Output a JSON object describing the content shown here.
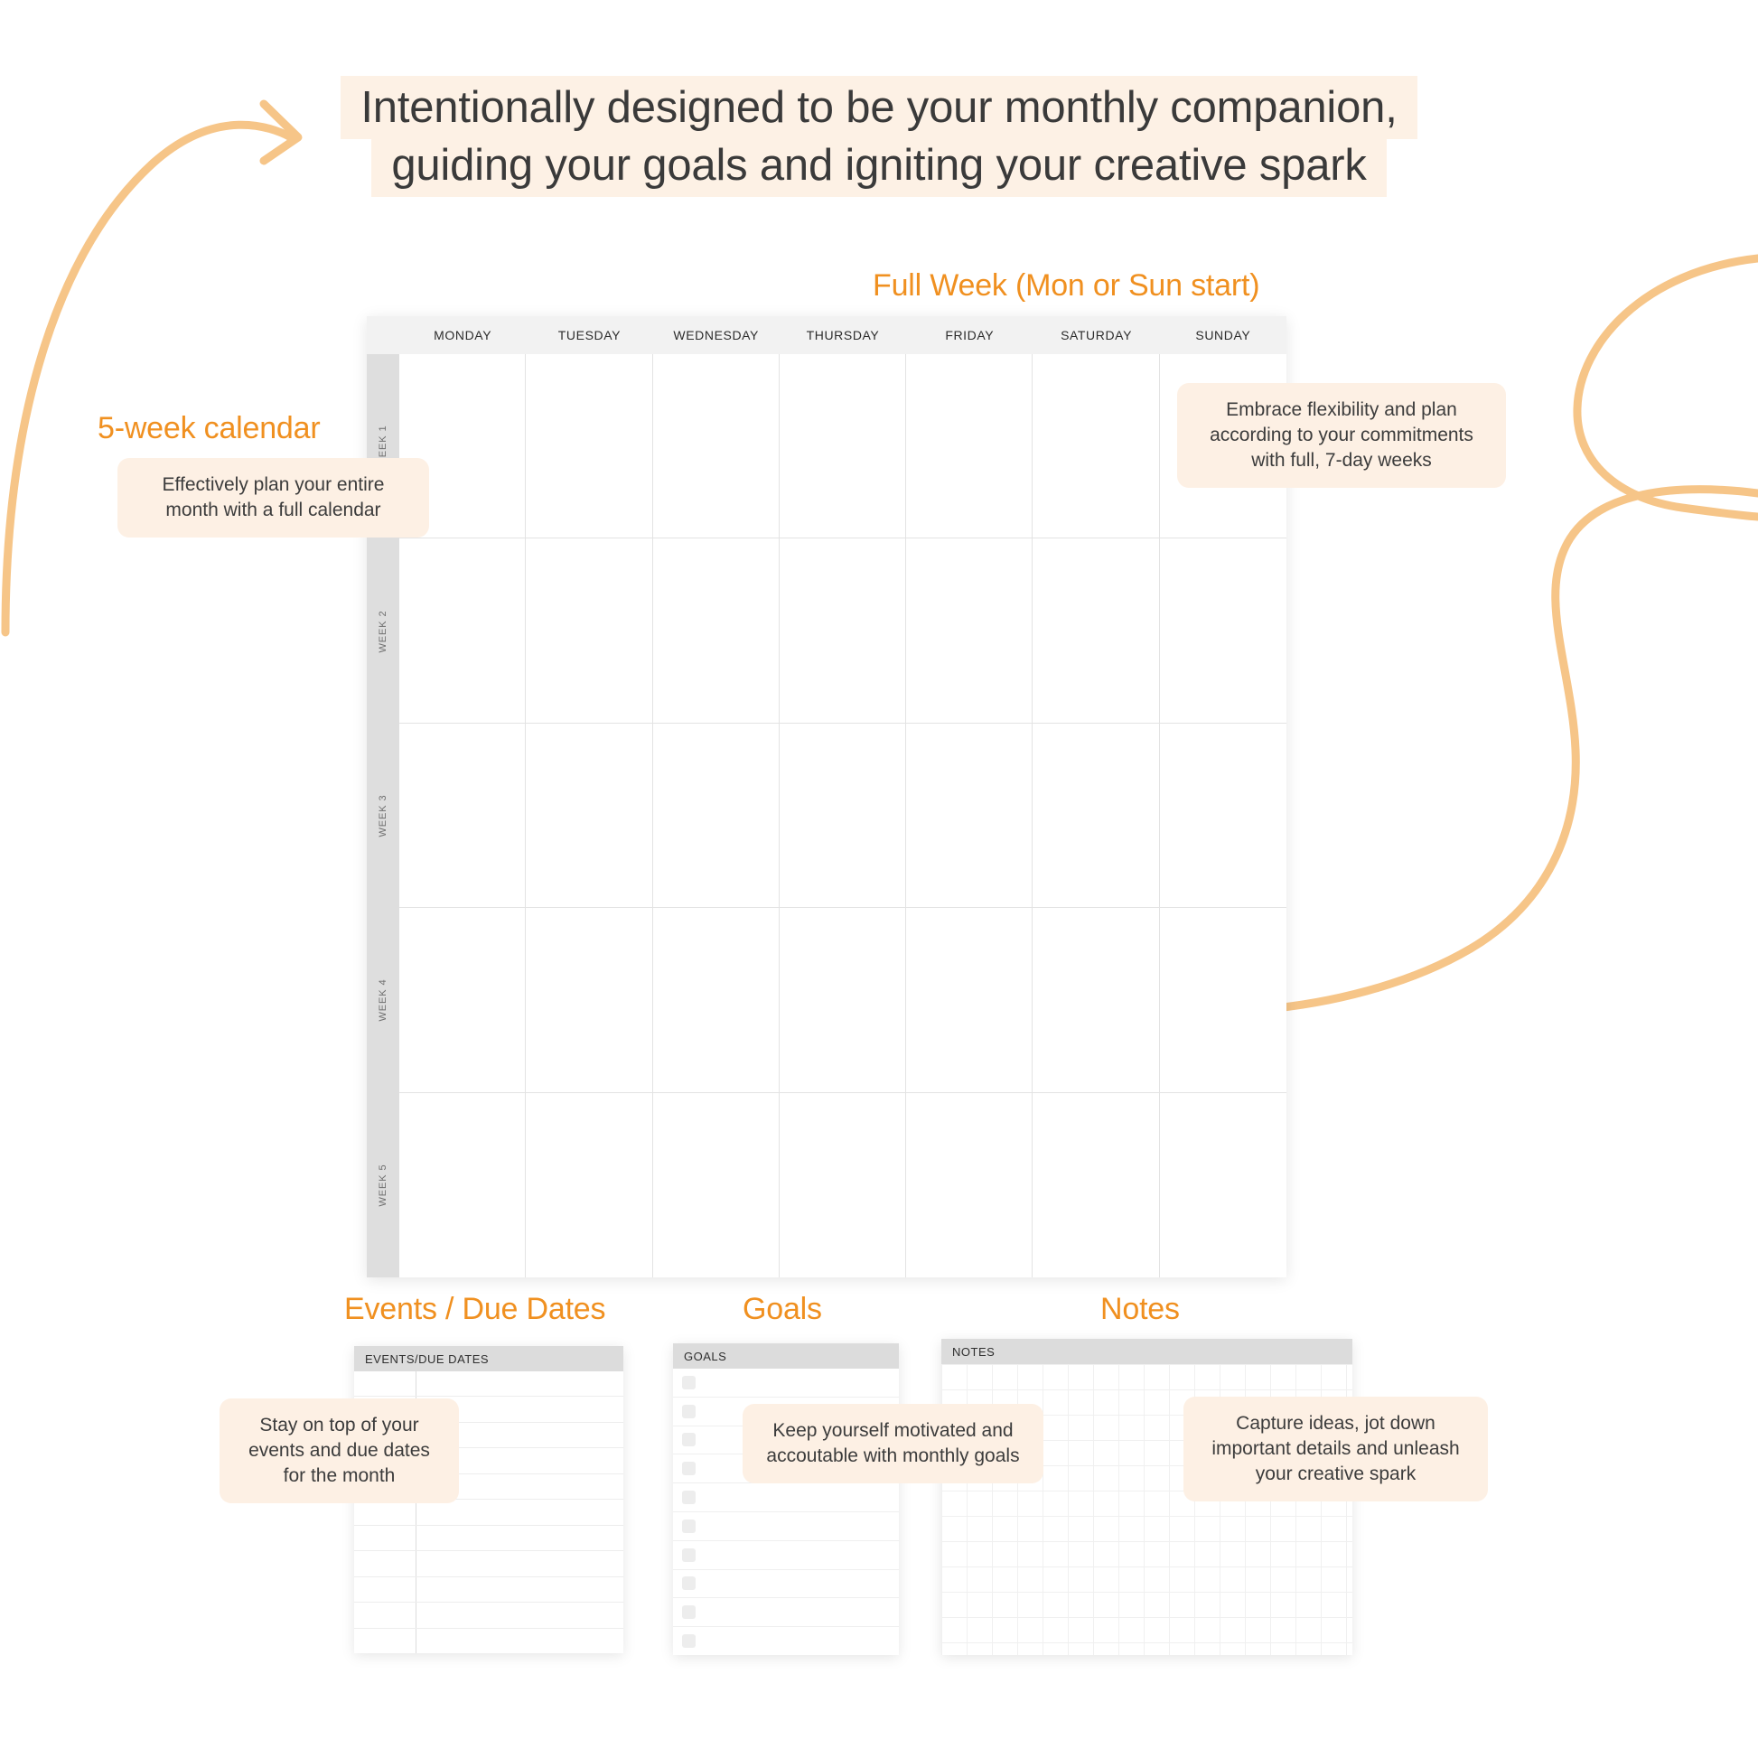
{
  "headline": {
    "line1": "Intentionally designed to be your monthly companion,",
    "line2": "guiding your goals and igniting your creative spark"
  },
  "colors": {
    "accent_orange": "#f09020",
    "callout_bg": "#fdf0e4",
    "headline_bg": "#fdf1e5",
    "swirl": "#f6c588",
    "header_gray": "#f2f2f2",
    "spine_gray": "#dedede",
    "card_header_gray": "#dcdcdc",
    "text_dark": "#3a3a3a"
  },
  "labels": {
    "full_week": "Full Week (Mon or Sun start)",
    "five_week_calendar": "5-week calendar",
    "events_due_dates": "Events / Due Dates",
    "goals": "Goals",
    "notes": "Notes"
  },
  "callouts": {
    "five_week": "Effectively plan your entire month with a full calendar",
    "seven_day": "Embrace flexibility and plan according to your commitments with full, 7-day weeks",
    "events": "Stay on top of your events and due dates for the month",
    "goals": "Keep yourself motivated and accoutable with monthly goals",
    "notes": "Capture ideas, jot down important details and unleash your creative spark"
  },
  "calendar": {
    "days": [
      "MONDAY",
      "TUESDAY",
      "WEDNESDAY",
      "THURSDAY",
      "FRIDAY",
      "SATURDAY",
      "SUNDAY"
    ],
    "weeks": [
      "WEEK 1",
      "WEEK 2",
      "WEEK 3",
      "WEEK 4",
      "WEEK 5"
    ],
    "rows": 5,
    "cols": 7
  },
  "cards": {
    "events": {
      "header": "EVENTS/DUE DATES",
      "row_count": 11
    },
    "goals": {
      "header": "GOALS",
      "row_count": 10
    },
    "notes": {
      "header": "NOTES",
      "grid_size_px": 28
    }
  },
  "decorations": {
    "left_arrow": "curved-arrow-icon",
    "right_swirl": "loop-swirl-icon"
  }
}
